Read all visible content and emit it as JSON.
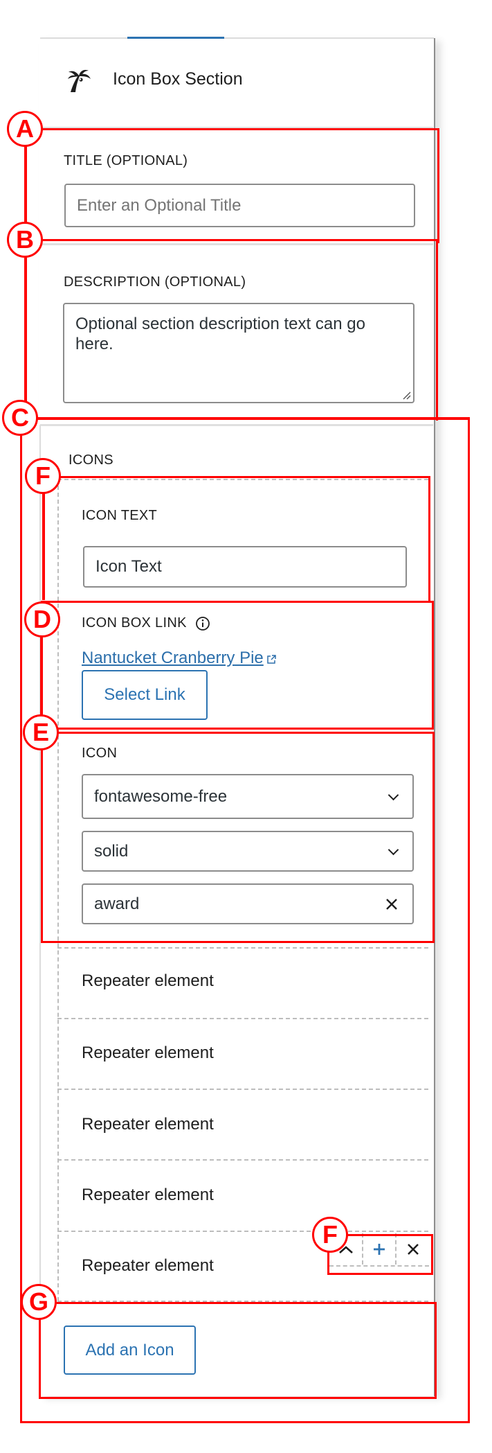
{
  "header": {
    "title": "Icon Box Section",
    "icon": "palm-tree-icon"
  },
  "title_field": {
    "label": "TITLE (OPTIONAL)",
    "placeholder": "Enter an Optional Title",
    "value": ""
  },
  "description_field": {
    "label": "DESCRIPTION (OPTIONAL)",
    "value": "Optional section description text can go here."
  },
  "icons": {
    "label": "ICONS",
    "item": {
      "icon_text": {
        "label": "ICON TEXT",
        "value": "Icon Text"
      },
      "icon_box_link": {
        "label": "ICON BOX LINK",
        "link_text": "Nantucket Cranberry Pie",
        "select_link_label": "Select Link"
      },
      "icon": {
        "label": "ICON",
        "library": "fontawesome-free",
        "style": "solid",
        "name": "award"
      }
    },
    "repeater_elements": [
      "Repeater element",
      "Repeater element",
      "Repeater element",
      "Repeater element",
      "Repeater element"
    ],
    "toolbar": {
      "move_up": "^",
      "add": "+",
      "remove": "×"
    },
    "add_button_label": "Add an Icon"
  },
  "annotations": [
    "A",
    "B",
    "C",
    "D",
    "E",
    "F",
    "F",
    "G"
  ],
  "colors": {
    "accent": "#2c73b2",
    "annotation": "#ff0000",
    "border": "#8c8c8c"
  }
}
